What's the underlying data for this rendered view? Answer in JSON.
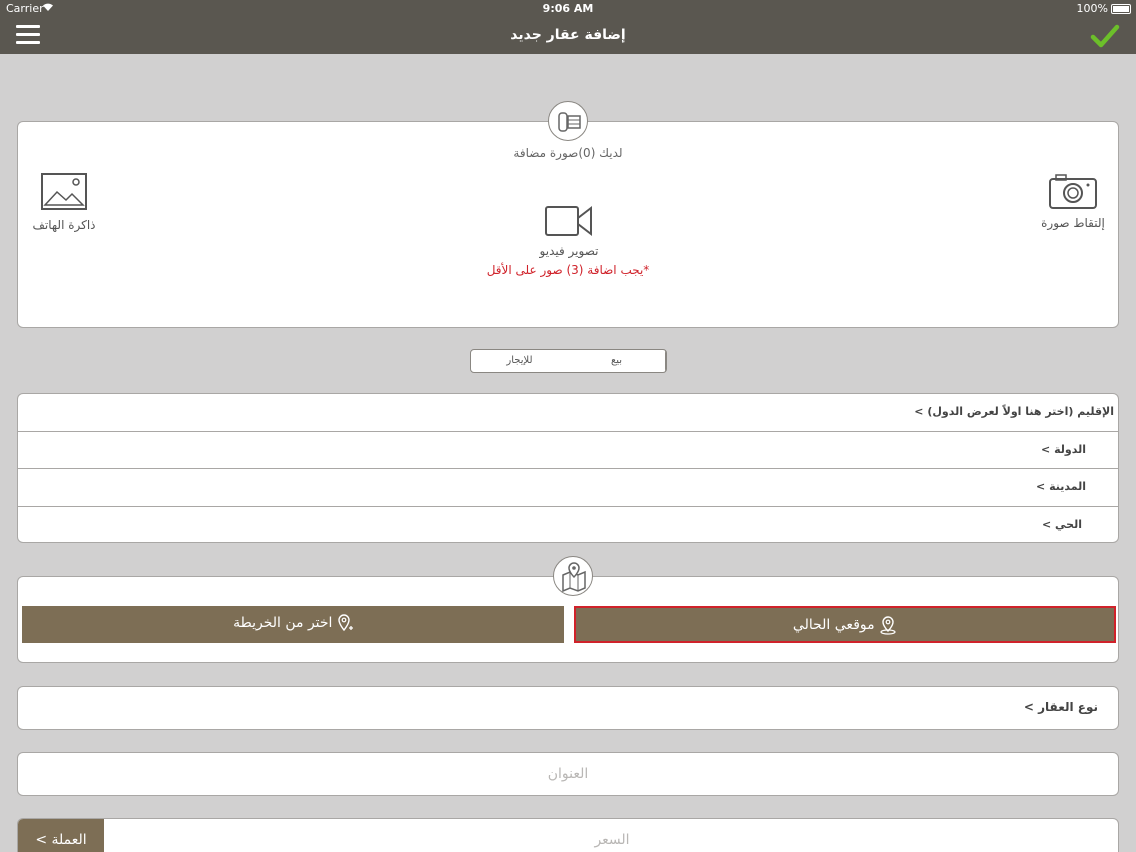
{
  "status_bar": {
    "carrier": "Carrier",
    "time": "9:06 AM",
    "battery": "100%"
  },
  "nav": {
    "title": "إضافة عقار جديد"
  },
  "media": {
    "count_text": "لديك (0)صورة مضافة",
    "camera_label": "إلتقاط صورة",
    "gallery_label": "ذاكرة الهاتف",
    "video_label": "تصوير فيديو",
    "requirement_note": "*يجب اضافة (3) صور على الأقل"
  },
  "listing_type": {
    "sale": "بيع",
    "rent": "للإيجار"
  },
  "location": {
    "region": "الإقليم (اختر هنا اولاً لعرض الدول) >",
    "country": "الدولة >",
    "city": "المدينة >",
    "district": "الحي >"
  },
  "map": {
    "current_location": "موقعي الحالي",
    "choose_from_map": "اختر من الخريطة"
  },
  "property_type": {
    "label": "نوع العقار >"
  },
  "fields": {
    "address_placeholder": "العنوان",
    "price_placeholder": "السعر",
    "currency_label": "العملة >"
  },
  "colors": {
    "nav_bg": "#5a5750",
    "accent_brown": "#7d6e55",
    "check_green": "#6cbf2a",
    "error_red": "#d0222a"
  }
}
